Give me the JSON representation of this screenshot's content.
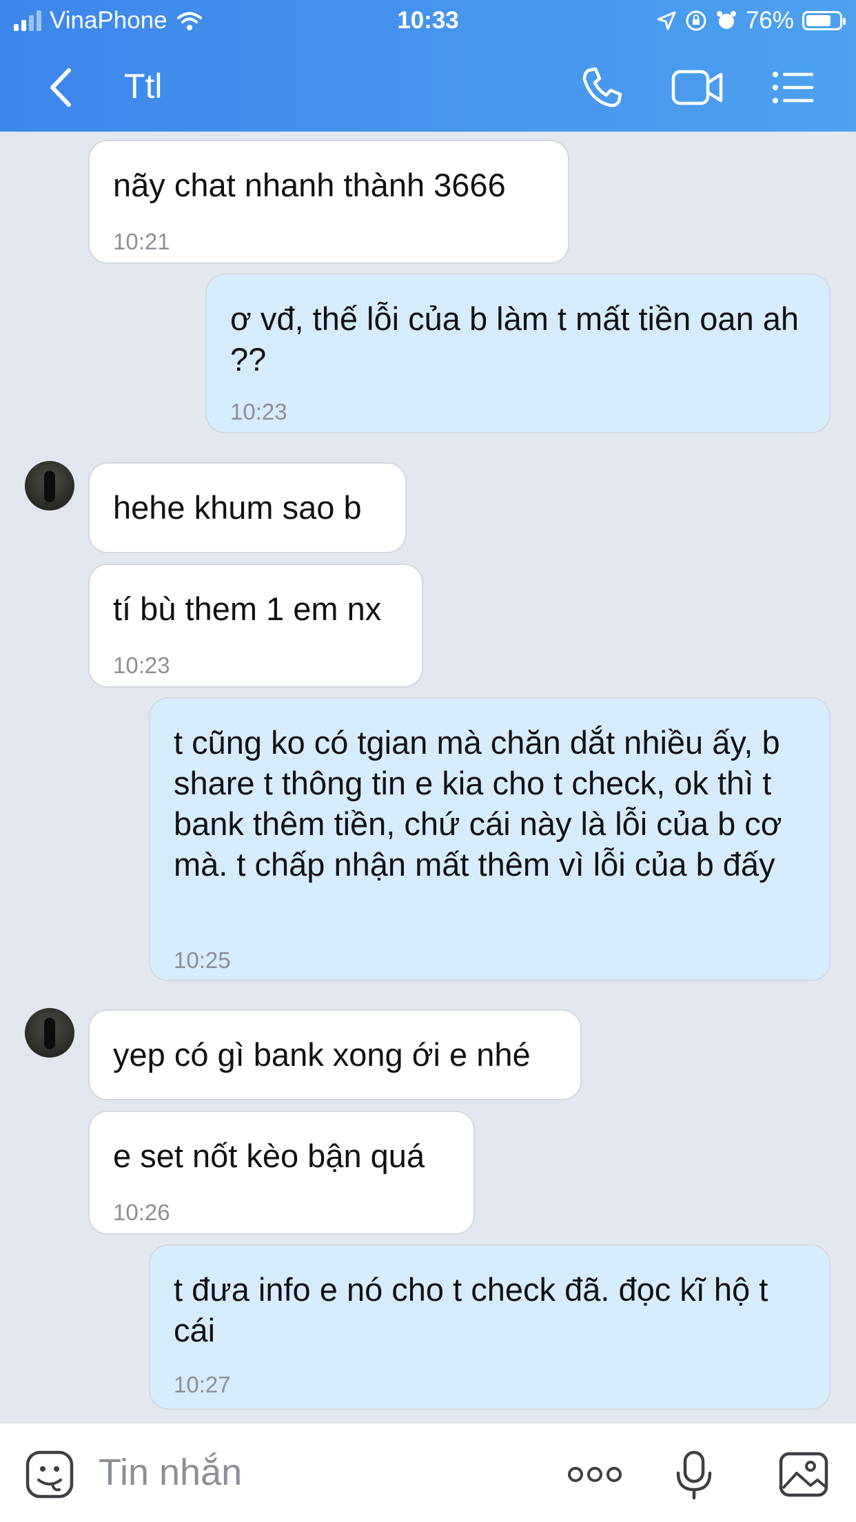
{
  "status_bar": {
    "carrier": "VinaPhone",
    "time": "10:33",
    "battery": "76%",
    "battery_level": 0.76
  },
  "header": {
    "title": "Ttl"
  },
  "icons": {
    "back": "chevron-left-icon",
    "call": "phone-icon",
    "video": "video-camera-icon",
    "menu": "list-menu-icon",
    "sticker": "sticker-face-icon",
    "more": "more-dots-icon",
    "mic": "microphone-icon",
    "image": "image-icon"
  },
  "messages": [
    {
      "direction": "incoming",
      "text": "nãy chat nhanh thành 3666",
      "time": "10:21",
      "avatar": false
    },
    {
      "direction": "outgoing",
      "text": "ơ vđ, thế lỗi của b làm t mất tiền oan ah ??",
      "time": "10:23"
    },
    {
      "direction": "incoming",
      "text": "hehe khum sao b",
      "time": "",
      "avatar": true
    },
    {
      "direction": "incoming",
      "text": "tí bù them 1 em nx",
      "time": "10:23",
      "avatar": false
    },
    {
      "direction": "outgoing",
      "text": "t cũng ko có tgian mà chăn dắt nhiều ấy, b share t thông tin e kia cho t check, ok thì t bank thêm tiền, chứ cái này là lỗi của b cơ mà. t chấp nhận mất thêm vì lỗi của b đấy",
      "time": "10:25"
    },
    {
      "direction": "incoming",
      "text": "yep có gì bank xong ới e nhé",
      "time": "",
      "avatar": true
    },
    {
      "direction": "incoming",
      "text": "e set nốt kèo bận quá",
      "time": "10:26",
      "avatar": false
    },
    {
      "direction": "outgoing",
      "text": "t đưa info e nó cho t check đã. đọc kĩ hộ t cái",
      "time": "10:27"
    }
  ],
  "composer": {
    "placeholder": "Tin nhắn"
  },
  "colors": {
    "header_start": "#3d86ec",
    "header_end": "#4da1ef",
    "background": "#e2e6ee",
    "incoming_bubble": "#ffffff",
    "outgoing_bubble": "#d6ecfd"
  }
}
